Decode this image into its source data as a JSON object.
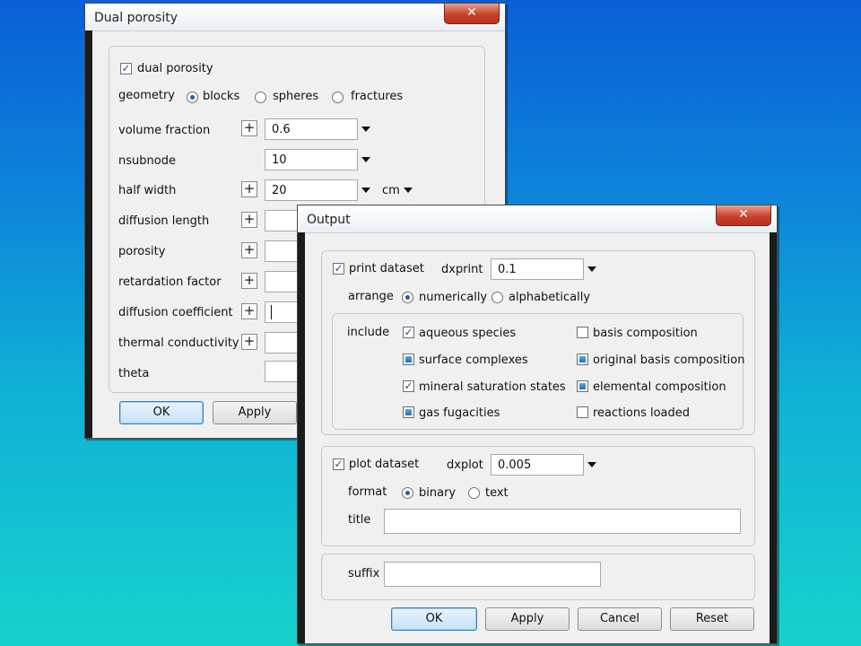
{
  "dual": {
    "title": "Dual porosity",
    "close": "✕",
    "dual_porosity": "dual porosity",
    "geometry_label": "geometry",
    "geometry_options": [
      "blocks",
      "spheres",
      "fractures"
    ],
    "rows": {
      "volume_fraction": {
        "label": "volume fraction",
        "value": "0.6"
      },
      "nsubnode": {
        "label": "nsubnode",
        "value": "10"
      },
      "half_width": {
        "label": "half width",
        "value": "20",
        "unit": "cm"
      },
      "diffusion_length": {
        "label": "diffusion length"
      },
      "porosity": {
        "label": "porosity"
      },
      "retardation_factor": {
        "label": "retardation factor"
      },
      "diffusion_coefficient": {
        "label": "diffusion coefficient"
      },
      "thermal_conductivity": {
        "label": "thermal conductivity"
      },
      "theta": {
        "label": "theta"
      }
    },
    "plus": "+",
    "ok": "OK",
    "apply": "Apply"
  },
  "output": {
    "title": "Output",
    "close": "✕",
    "print_dataset": "print dataset",
    "dxprint_label": "dxprint",
    "dxprint_value": "0.1",
    "arrange_label": "arrange",
    "arrange_options": [
      "numerically",
      "alphabetically"
    ],
    "include_label": "include",
    "include_items": [
      "aqueous species",
      "basis composition",
      "surface complexes",
      "original basis composition",
      "mineral saturation states",
      "elemental composition",
      "gas fugacities",
      "reactions loaded"
    ],
    "plot_dataset": "plot dataset",
    "dxplot_label": "dxplot",
    "dxplot_value": "0.005",
    "format_label": "format",
    "format_options": [
      "binary",
      "text"
    ],
    "title_label": "title",
    "title_value": "",
    "suffix_label": "suffix",
    "suffix_value": "",
    "ok": "OK",
    "apply": "Apply",
    "cancel": "Cancel",
    "reset": "Reset"
  }
}
